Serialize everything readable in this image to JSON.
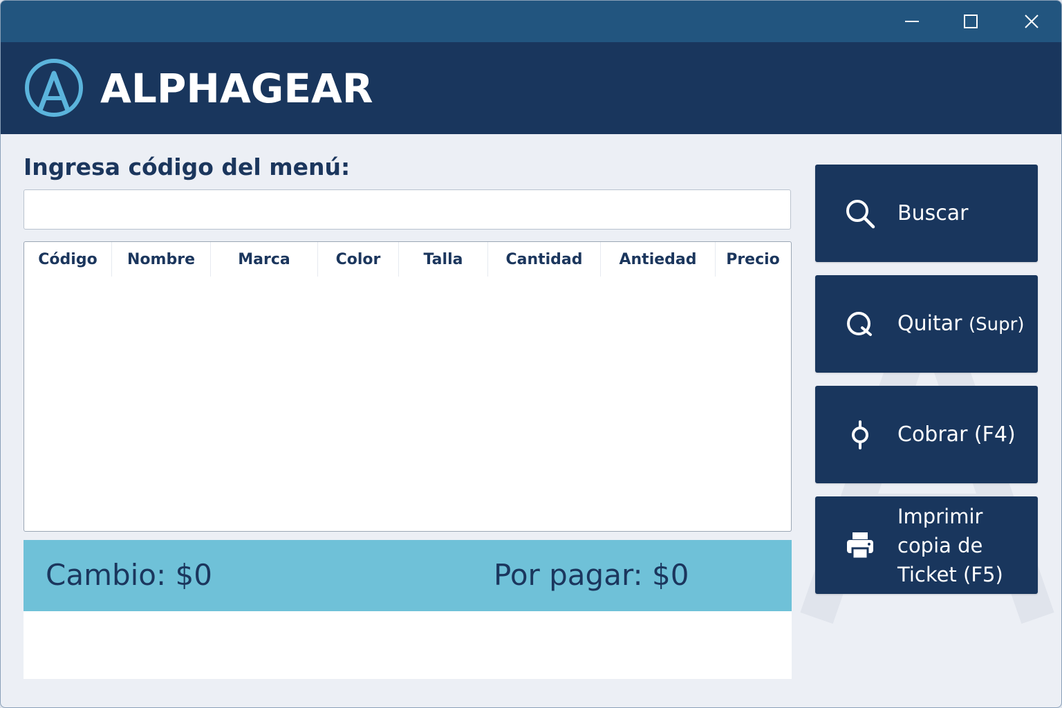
{
  "window": {
    "controls": {
      "minimize_icon": "minimize-icon",
      "maximize_icon": "maximize-icon",
      "close_icon": "close-icon"
    }
  },
  "header": {
    "logo_icon": "alphagear-logo",
    "brand": "ALPHAGEAR"
  },
  "search": {
    "label": "Ingresa código del menú:",
    "value": "",
    "placeholder": ""
  },
  "table": {
    "columns": [
      "Código",
      "Nombre",
      "Marca",
      "Color",
      "Talla",
      "Cantidad",
      "Antiedad",
      "Precio"
    ],
    "rows": []
  },
  "totals": {
    "cambio": "Cambio: $0",
    "por_pagar": "Por pagar: $0"
  },
  "actions": {
    "buscar": {
      "label": "Buscar",
      "icon": "search-icon"
    },
    "quitar": {
      "label": "Quitar",
      "shortcut": "(Supr)",
      "icon": "remove-icon"
    },
    "cobrar": {
      "label": "Cobrar (F4)",
      "icon": "pay-icon"
    },
    "imprimir": {
      "label": "Imprimir copia de Ticket (F5)",
      "icon": "printer-icon"
    }
  },
  "colors": {
    "titlebar": "#22557f",
    "header": "#19365d",
    "accent": "#6fc1d8",
    "logo": "#5bb4dc",
    "text_dark": "#1b365d",
    "background": "#eceff5"
  }
}
